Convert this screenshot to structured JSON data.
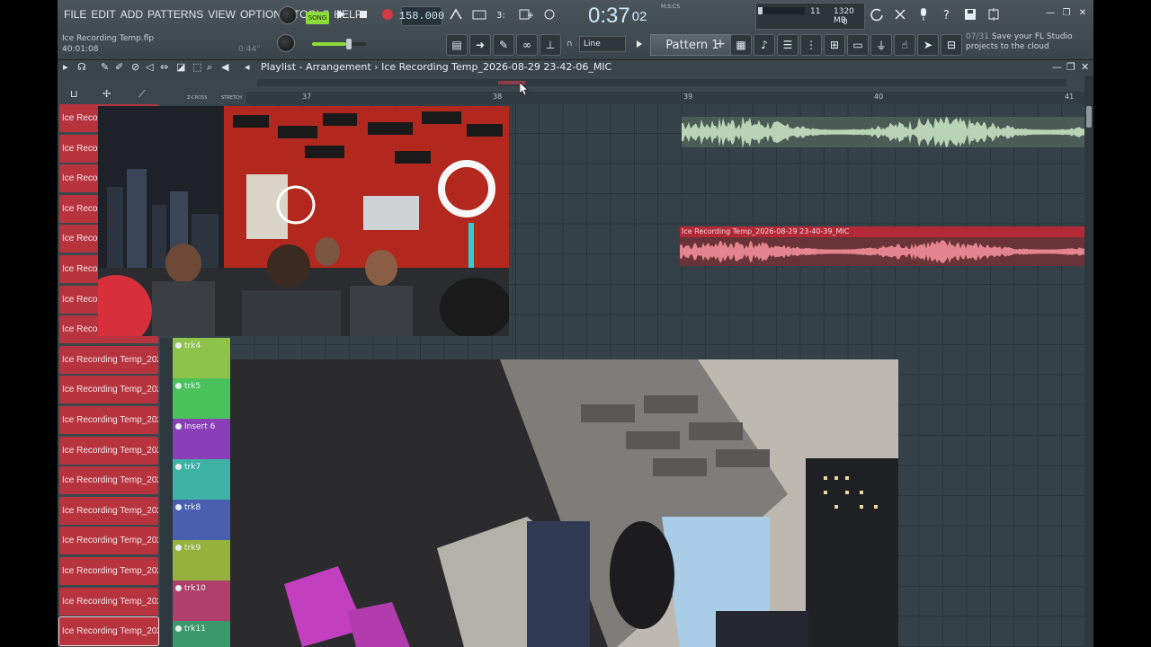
{
  "menu": [
    "FILE",
    "EDIT",
    "ADD",
    "PATTERNS",
    "VIEW",
    "OPTIONS",
    "TOOLS",
    "HELP"
  ],
  "transport": {
    "song_label": "SONG",
    "tempo": "158.000",
    "time_main": "0:37",
    "time_sub": "02",
    "time_unit": "M:S:CS"
  },
  "cpu": {
    "voices": "11",
    "memory": "1320 MB",
    "polyphony": "0"
  },
  "project": {
    "file": "Ice Recording Temp.flp",
    "elapsed": "40:01:08",
    "right_time": "0:44\""
  },
  "snap": {
    "value": "Line"
  },
  "pattern": {
    "name": "Pattern 1"
  },
  "news": {
    "count": "07/31",
    "line1": "Save your FL Studio",
    "line2": "projects to the cloud"
  },
  "playlist": {
    "title": "Playlist - Arrangement",
    "breadcrumb_sep": "›",
    "clip_path": "Ice Recording Temp_2026-08-29 23-42-06_MIC",
    "z_cross": "Z-CROSS",
    "stretch": "STRETCH",
    "ruler_marks": [
      "37",
      "38",
      "39",
      "40",
      "41"
    ]
  },
  "tracks": [
    "Ice Recor",
    "Ice Recor",
    "Ice Recor",
    "Ice Recor",
    "Ice Recor",
    "Ice Recor",
    "Ice Recor",
    "Ice Recor",
    "Ice Recording Temp_202...",
    "Ice Recording Temp_202...",
    "Ice Recording Temp_202...",
    "Ice Recording Temp_202...",
    "Ice Recording Temp_202...",
    "Ice Recording Temp_202...",
    "Ice Recording Temp_202...",
    "Ice Recording Temp_202...",
    "Ice Recording Temp_202...",
    "Ice Recording Temp_202..."
  ],
  "mixer_tracks": [
    {
      "label": "trk4",
      "color": "#8fc24a"
    },
    {
      "label": "trk5",
      "color": "#49c25b"
    },
    {
      "label": "Insert 6",
      "color": "#8a3fb8"
    },
    {
      "label": "trk7",
      "color": "#3fb2a6"
    },
    {
      "label": "trk8",
      "color": "#4a5fb0"
    },
    {
      "label": "trk9",
      "color": "#96b23c"
    },
    {
      "label": "trk10",
      "color": "#b0406b"
    },
    {
      "label": "trk11",
      "color": "#3a9a6d"
    }
  ],
  "clip2": {
    "name": "Ice Recording Temp_2026-08-29 23-40-39_MIC"
  },
  "icons": {
    "play": "play-icon",
    "stop": "stop-icon",
    "record": "record-icon",
    "close": "close-icon"
  },
  "colors": {
    "track_red": "#b7343f",
    "clip_red": "#b32a36",
    "wave_green": "#b9d4b5",
    "accent_green": "#8ddc3a"
  }
}
